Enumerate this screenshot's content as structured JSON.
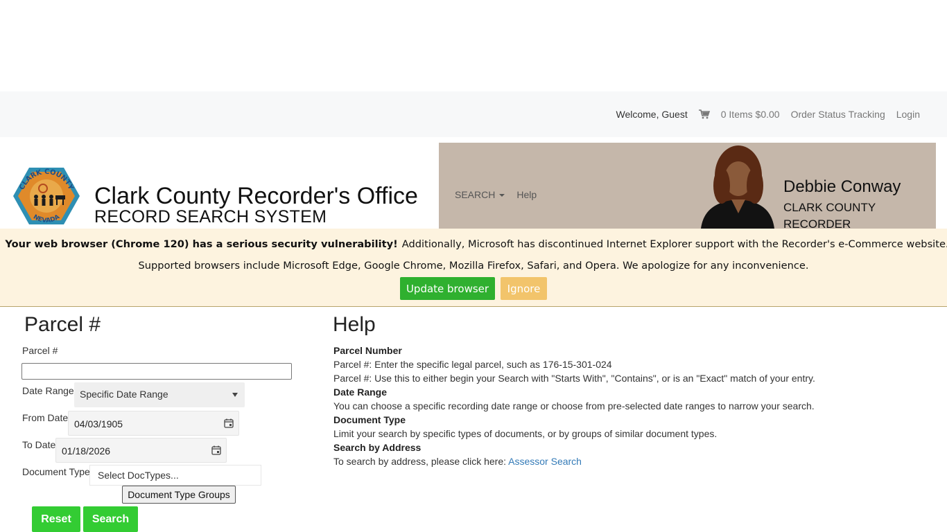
{
  "topbar": {
    "welcome": "Welcome, Guest",
    "cart": "0 Items $0.00",
    "order_status": "Order Status Tracking",
    "login": "Login"
  },
  "header": {
    "title": "Clark County Recorder's Office",
    "subtitle": "RECORD SEARCH SYSTEM",
    "logo_text_top": "CLARK COUNTY",
    "logo_text_bottom": "NEVADA",
    "nav": {
      "search": "SEARCH",
      "help": "Help"
    },
    "recorder_name": "Debbie Conway",
    "recorder_title_line1": "CLARK COUNTY",
    "recorder_title_line2": "RECORDER",
    "banner_color": "#c5b7aa"
  },
  "alert": {
    "bold": "Your web browser (Chrome 120) has a serious security vulnerability!",
    "rest": "Additionally, Microsoft has discontinued Internet Explorer support with the Recorder's e-Commerce website.",
    "line2": "Supported browsers include Microsoft Edge, Google Chrome, Mozilla Firefox, Safari, and Opera. We apologize for any inconvenience.",
    "update_button": "Update browser",
    "ignore_button": "Ignore"
  },
  "form": {
    "heading": "Parcel #",
    "parcel_label": "Parcel #",
    "parcel_value": "",
    "date_range_label": "Date Range",
    "date_range_value": "Specific Date Range",
    "from_label": "From Date",
    "from_value": "04/03/1905",
    "to_label": "To Date",
    "to_value": "01/18/2026",
    "doctype_label": "Document Type",
    "doctype_placeholder": "Select DocTypes...",
    "doctype_groups_button": "Document Type Groups",
    "reset_button": "Reset",
    "search_button": "Search"
  },
  "help": {
    "heading": "Help",
    "parcel_number_title": "Parcel Number",
    "parcel_line1": "Parcel #: Enter the specific legal parcel, such as 176-15-301-024",
    "parcel_line2": "Parcel #: Use this to either begin your Search with \"Starts With\", \"Contains\", or is an \"Exact\" match of your entry.",
    "date_range_title": "Date Range",
    "date_range_text": "You can choose a specific recording date range or choose from pre-selected date ranges to narrow your search.",
    "doc_type_title": "Document Type",
    "doc_type_text": "Limit your search by specific types of documents, or by groups of similar document types.",
    "address_title": "Search by Address",
    "address_text": "To search by address, please click here: ",
    "assessor_link": "Assessor Search"
  }
}
